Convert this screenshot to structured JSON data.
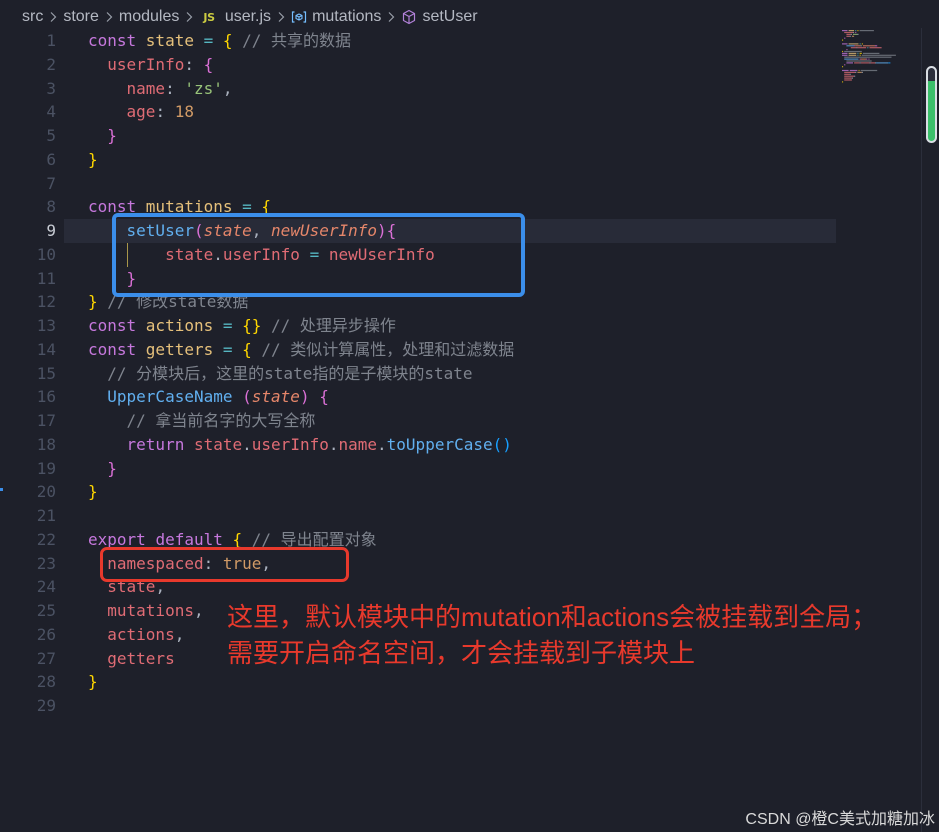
{
  "theme": {
    "background": "#1e202a",
    "foreground": "#abb2bf",
    "line_number": "#4b5263",
    "line_number_active": "#c8ccd4",
    "current_line": "#282b38"
  },
  "breadcrumb": {
    "separator_icon": "chevron-right-icon",
    "items": [
      {
        "label": "src"
      },
      {
        "label": "store"
      },
      {
        "label": "modules"
      },
      {
        "label": "user.js",
        "icon": "js-file-icon",
        "icon_text": "JS"
      },
      {
        "label": "mutations",
        "icon": "symbol-variable-icon"
      },
      {
        "label": "setUser",
        "icon": "symbol-method-icon"
      }
    ]
  },
  "editor": {
    "active_line": 9,
    "lines": [
      {
        "n": 1,
        "tokens": [
          {
            "t": "const ",
            "c": "#c678dd"
          },
          {
            "t": "state ",
            "c": "#e5c07b"
          },
          {
            "t": "= ",
            "c": "#56b6c2"
          },
          {
            "t": "{ ",
            "c": "#ffd700"
          },
          {
            "t": "// 共享的数据",
            "c": "#7f848e"
          }
        ]
      },
      {
        "n": 2,
        "tokens": [
          {
            "t": "  userInfo",
            "c": "#e06c75"
          },
          {
            "t": ": ",
            "c": "#abb2bf"
          },
          {
            "t": "{",
            "c": "#da70d6"
          }
        ]
      },
      {
        "n": 3,
        "tokens": [
          {
            "t": "    name",
            "c": "#e06c75"
          },
          {
            "t": ": ",
            "c": "#abb2bf"
          },
          {
            "t": "'zs'",
            "c": "#98c379"
          },
          {
            "t": ",",
            "c": "#abb2bf"
          }
        ]
      },
      {
        "n": 4,
        "tokens": [
          {
            "t": "    age",
            "c": "#e06c75"
          },
          {
            "t": ": ",
            "c": "#abb2bf"
          },
          {
            "t": "18",
            "c": "#d19a66"
          }
        ]
      },
      {
        "n": 5,
        "tokens": [
          {
            "t": "  }",
            "c": "#da70d6"
          }
        ]
      },
      {
        "n": 6,
        "tokens": [
          {
            "t": "}",
            "c": "#ffd700"
          }
        ]
      },
      {
        "n": 7,
        "tokens": []
      },
      {
        "n": 8,
        "tokens": [
          {
            "t": "const ",
            "c": "#c678dd"
          },
          {
            "t": "mutations ",
            "c": "#e5c07b"
          },
          {
            "t": "= ",
            "c": "#56b6c2"
          },
          {
            "t": "{",
            "c": "#ffd700"
          }
        ]
      },
      {
        "n": 9,
        "tokens": [
          {
            "t": "    setUser",
            "c": "#61afef"
          },
          {
            "t": "(",
            "c": "#da70d6"
          },
          {
            "t": "state",
            "c": "#e5866a",
            "i": true
          },
          {
            "t": ", ",
            "c": "#abb2bf"
          },
          {
            "t": "newUserInfo",
            "c": "#e5866a",
            "i": true
          },
          {
            "t": ")",
            "c": "#da70d6"
          },
          {
            "t": "{",
            "c": "#da70d6"
          }
        ]
      },
      {
        "n": 10,
        "tokens": [
          {
            "t": "        state",
            "c": "#e06c75"
          },
          {
            "t": ".",
            "c": "#abb2bf"
          },
          {
            "t": "userInfo ",
            "c": "#e06c75"
          },
          {
            "t": "= ",
            "c": "#56b6c2"
          },
          {
            "t": "newUserInfo",
            "c": "#e06c75"
          }
        ]
      },
      {
        "n": 11,
        "tokens": [
          {
            "t": "    }",
            "c": "#da70d6"
          }
        ]
      },
      {
        "n": 12,
        "tokens": [
          {
            "t": "} ",
            "c": "#ffd700"
          },
          {
            "t": "// 修改state数据",
            "c": "#7f848e"
          }
        ]
      },
      {
        "n": 13,
        "tokens": [
          {
            "t": "const ",
            "c": "#c678dd"
          },
          {
            "t": "actions ",
            "c": "#e5c07b"
          },
          {
            "t": "= ",
            "c": "#56b6c2"
          },
          {
            "t": "{}",
            "c": "#ffd700"
          },
          {
            "t": " // 处理异步操作",
            "c": "#7f848e"
          }
        ]
      },
      {
        "n": 14,
        "tokens": [
          {
            "t": "const ",
            "c": "#c678dd"
          },
          {
            "t": "getters ",
            "c": "#e5c07b"
          },
          {
            "t": "= ",
            "c": "#56b6c2"
          },
          {
            "t": "{ ",
            "c": "#ffd700"
          },
          {
            "t": "// 类似计算属性，处理和过滤数据",
            "c": "#7f848e"
          }
        ]
      },
      {
        "n": 15,
        "tokens": [
          {
            "t": "  // 分模块后，这里的state指的是子模块的state",
            "c": "#7f848e"
          }
        ]
      },
      {
        "n": 16,
        "tokens": [
          {
            "t": "  UpperCaseName ",
            "c": "#61afef"
          },
          {
            "t": "(",
            "c": "#da70d6"
          },
          {
            "t": "state",
            "c": "#e5866a",
            "i": true
          },
          {
            "t": ") ",
            "c": "#da70d6"
          },
          {
            "t": "{",
            "c": "#da70d6"
          }
        ]
      },
      {
        "n": 17,
        "tokens": [
          {
            "t": "    // 拿当前名字的大写全称",
            "c": "#7f848e"
          }
        ]
      },
      {
        "n": 18,
        "tokens": [
          {
            "t": "    return ",
            "c": "#c678dd"
          },
          {
            "t": "state",
            "c": "#e06c75"
          },
          {
            "t": ".",
            "c": "#abb2bf"
          },
          {
            "t": "userInfo",
            "c": "#e06c75"
          },
          {
            "t": ".",
            "c": "#abb2bf"
          },
          {
            "t": "name",
            "c": "#e06c75"
          },
          {
            "t": ".",
            "c": "#abb2bf"
          },
          {
            "t": "toUpperCase",
            "c": "#61afef"
          },
          {
            "t": "()",
            "c": "#179fff"
          }
        ]
      },
      {
        "n": 19,
        "tokens": [
          {
            "t": "  }",
            "c": "#da70d6"
          }
        ]
      },
      {
        "n": 20,
        "tokens": [
          {
            "t": "}",
            "c": "#ffd700"
          }
        ]
      },
      {
        "n": 21,
        "tokens": []
      },
      {
        "n": 22,
        "tokens": [
          {
            "t": "export ",
            "c": "#c678dd"
          },
          {
            "t": "default ",
            "c": "#c678dd"
          },
          {
            "t": "{ ",
            "c": "#ffd700"
          },
          {
            "t": "// 导出配置对象",
            "c": "#7f848e"
          }
        ]
      },
      {
        "n": 23,
        "tokens": [
          {
            "t": "  namespaced",
            "c": "#e06c75"
          },
          {
            "t": ": ",
            "c": "#abb2bf"
          },
          {
            "t": "true",
            "c": "#d19a66"
          },
          {
            "t": ",",
            "c": "#abb2bf"
          }
        ]
      },
      {
        "n": 24,
        "tokens": [
          {
            "t": "  state",
            "c": "#e06c75"
          },
          {
            "t": ",",
            "c": "#abb2bf"
          }
        ]
      },
      {
        "n": 25,
        "tokens": [
          {
            "t": "  mutations",
            "c": "#e06c75"
          },
          {
            "t": ",",
            "c": "#abb2bf"
          }
        ]
      },
      {
        "n": 26,
        "tokens": [
          {
            "t": "  actions",
            "c": "#e06c75"
          },
          {
            "t": ",",
            "c": "#abb2bf"
          }
        ]
      },
      {
        "n": 27,
        "tokens": [
          {
            "t": "  getters",
            "c": "#e06c75"
          }
        ]
      },
      {
        "n": 28,
        "tokens": [
          {
            "t": "}",
            "c": "#ffd700"
          }
        ]
      },
      {
        "n": 29,
        "tokens": []
      }
    ]
  },
  "annotations": {
    "blue_box_color": "#3b8eea",
    "red_box_color": "#e8392c",
    "note_color": "#e8392c",
    "note_lines": [
      "这里，默认模块中的mutation和actions会被挂载到全局；",
      "需要开启命名空间，才会挂载到子模块上"
    ]
  },
  "watermark": "CSDN @橙C美式加糖加冰"
}
